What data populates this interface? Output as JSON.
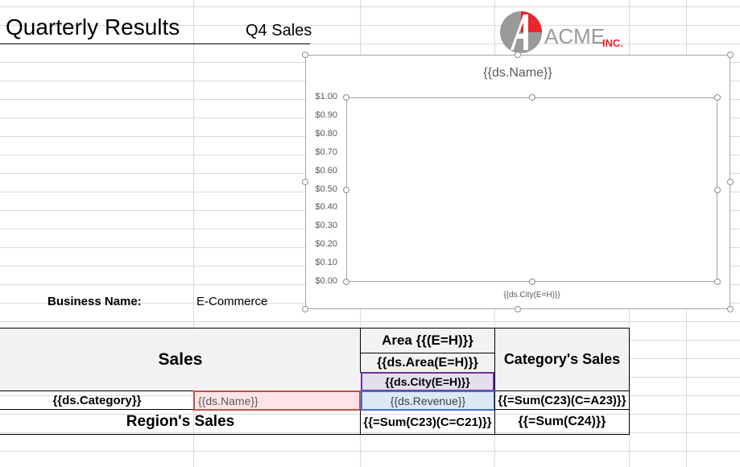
{
  "sheet": {
    "title": "Quarterly Results",
    "subtitle": "Q4 Sales"
  },
  "logo": {
    "brand": "ACME",
    "suffix": "INC.",
    "colors": {
      "gray": "#9a9a9a",
      "red": "#e8262b"
    }
  },
  "chart_data": {
    "type": "bar",
    "title": "{{ds.Name}}",
    "categories": [
      "{{ds.City(E=H)}}"
    ],
    "series": [],
    "ylim": [
      0,
      1
    ],
    "yticks": [
      "$0.00",
      "$0.10",
      "$0.20",
      "$0.30",
      "$0.40",
      "$0.50",
      "$0.60",
      "$0.70",
      "$0.80",
      "$0.90",
      "$1.00"
    ],
    "grid": false,
    "legend": "none"
  },
  "business": {
    "label": "Business Name:",
    "value": "E-Commerce"
  },
  "table": {
    "sales_header": "Sales",
    "area_header": "Area {{(E=H)}}",
    "area_field": "{{ds.Area(E=H)}}",
    "city_field": "{{ds.City(E=H)}}",
    "category_sales_header": "Category's Sales",
    "category_field": "{{ds.Category}}",
    "name_field": "{{ds.Name}}",
    "revenue_field": "{{ds.Revenue}}",
    "category_sum": "{{=Sum(C23)(C=A23)}}",
    "region_label": "Region's Sales",
    "region_sum": "{{=Sum(C23)(C=C21)}}",
    "grand_sum": "{{=Sum(C24)}}"
  },
  "colors": {
    "header_bg": "#f2f2f2",
    "city_bg": "#e4dfec",
    "city_border": "#7030a0",
    "name_bg": "#fce4e8",
    "name_border": "#c0504d",
    "revenue_bg": "#dde8f5",
    "revenue_border": "#4472c4"
  }
}
